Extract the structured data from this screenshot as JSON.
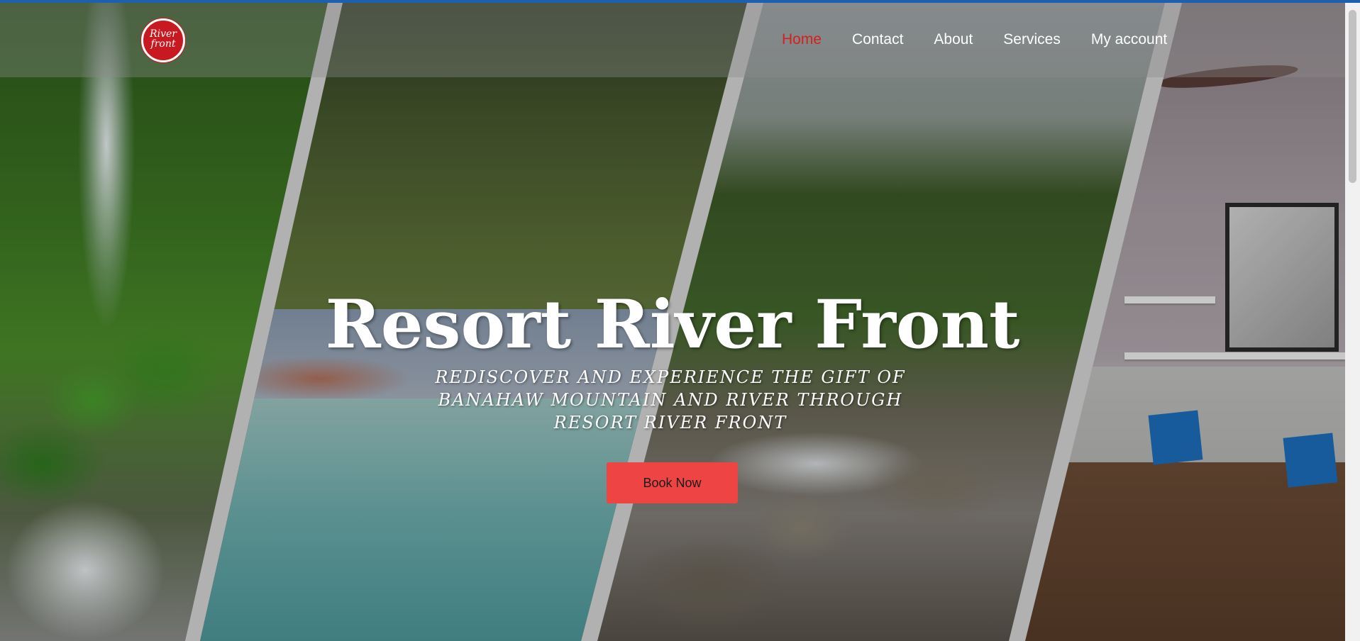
{
  "brand": {
    "logo_line1": "River",
    "logo_line2": "front"
  },
  "nav": {
    "items": [
      {
        "label": "Home",
        "active": true
      },
      {
        "label": "Contact",
        "active": false
      },
      {
        "label": "About",
        "active": false
      },
      {
        "label": "Services",
        "active": false
      },
      {
        "label": "My account",
        "active": false
      }
    ]
  },
  "hero": {
    "title": "Resort River Front",
    "subtitle": "REDISCOVER AND EXPERIENCE THE GIFT OF BANAHAW MOUNTAIN AND RIVER THROUGH RESORT RIVER FRONT",
    "cta_label": "Book Now",
    "panels": [
      "waterfall",
      "pool",
      "river",
      "living-room"
    ]
  },
  "colors": {
    "accent": "#ee4444",
    "active_nav": "#d61f1f",
    "top_bar": "#1f5fb0"
  }
}
